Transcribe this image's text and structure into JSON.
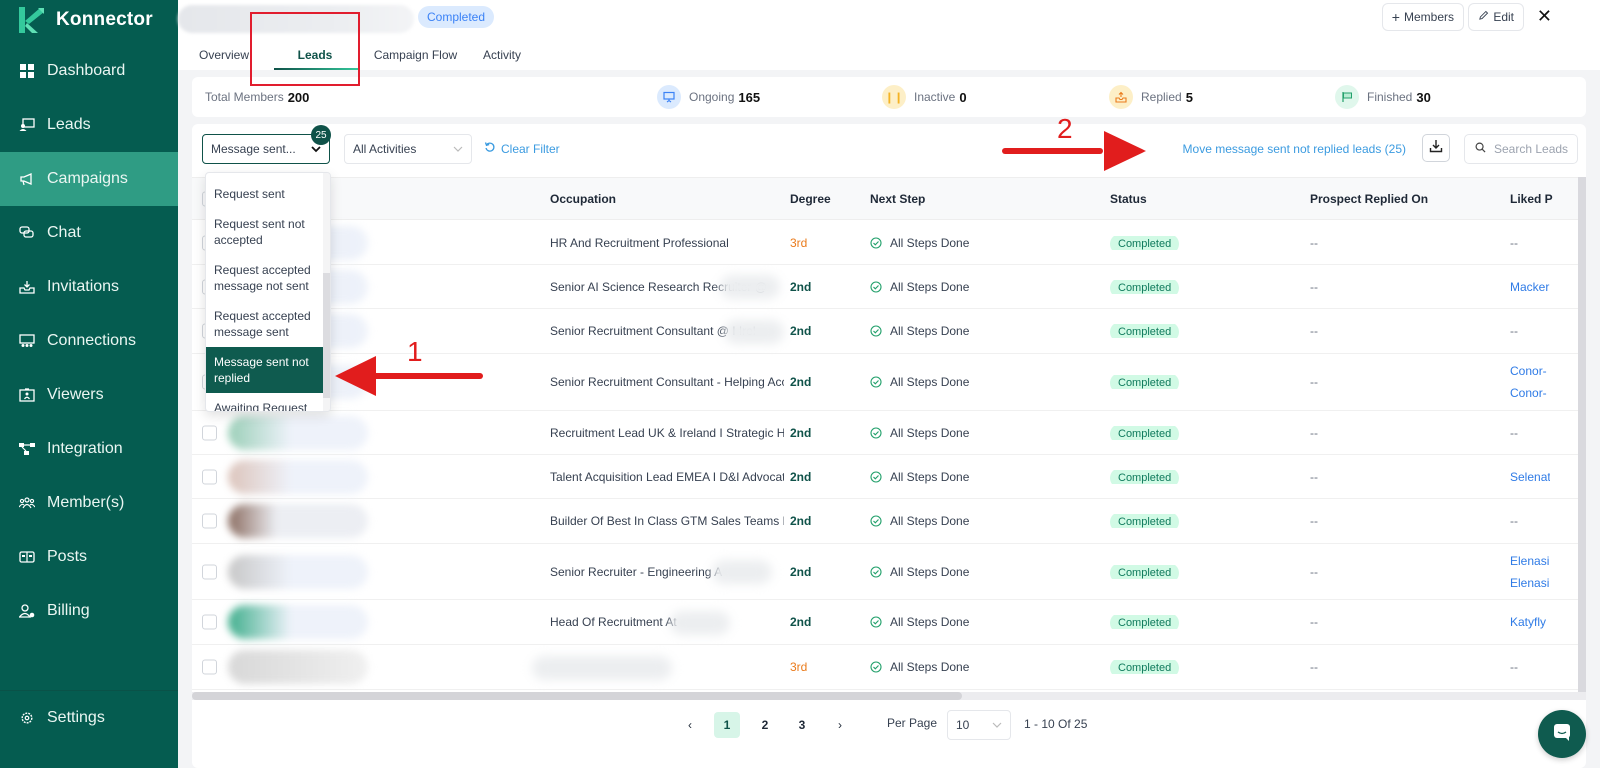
{
  "app": {
    "name": "Konnector"
  },
  "sidebar": {
    "items": [
      {
        "label": "Dashboard",
        "icon": "dashboard-icon"
      },
      {
        "label": "Leads",
        "icon": "leads-icon"
      },
      {
        "label": "Campaigns",
        "icon": "megaphone-icon",
        "active": true
      },
      {
        "label": "Chat",
        "icon": "chat-icon"
      },
      {
        "label": "Invitations",
        "icon": "inbox-download-icon"
      },
      {
        "label": "Connections",
        "icon": "connections-icon"
      },
      {
        "label": "Viewers",
        "icon": "id-badge-icon"
      },
      {
        "label": "Integration",
        "icon": "integration-icon"
      },
      {
        "label": "Member(s)",
        "icon": "members-icon"
      },
      {
        "label": "Posts",
        "icon": "posts-icon"
      },
      {
        "label": "Billing",
        "icon": "billing-user-icon"
      }
    ],
    "settings_label": "Settings"
  },
  "header": {
    "status": "Completed",
    "members_button": "Members",
    "edit_button": "Edit",
    "tabs": [
      {
        "label": "Overview"
      },
      {
        "label": "Leads",
        "active": true
      },
      {
        "label": "Campaign Flow"
      },
      {
        "label": "Activity"
      }
    ]
  },
  "stats": {
    "total_members": {
      "label": "Total Members",
      "value": "200"
    },
    "ongoing": {
      "label": "Ongoing",
      "value": "165"
    },
    "inactive": {
      "label": "Inactive",
      "value": "0"
    },
    "replied": {
      "label": "Replied",
      "value": "5"
    },
    "finished": {
      "label": "Finished",
      "value": "30"
    }
  },
  "filters": {
    "status_filter": {
      "value": "Message sent...",
      "badge": "25"
    },
    "activity_filter": {
      "value": "All Activities"
    },
    "clear_label": "Clear Filter",
    "move_link": "Move message sent not replied leads (25)",
    "search_placeholder": "Search Leads",
    "dropdown_options": [
      {
        "label": "Request sent"
      },
      {
        "label": "Request sent not accepted"
      },
      {
        "label": "Request accepted message not sent"
      },
      {
        "label": "Request accepted message sent"
      },
      {
        "label": "Message sent not replied",
        "selected": true
      },
      {
        "label": "Awaiting Request"
      }
    ]
  },
  "table": {
    "columns": [
      "Occupation",
      "Degree",
      "Next Step",
      "Status",
      "Prospect Replied On",
      "Liked P"
    ],
    "rows": [
      {
        "occupation": "HR And Recruitment Professional",
        "degree": "3rd",
        "next_step": "All Steps Done",
        "status": "Completed",
        "replied_on": "--",
        "liked": [
          "--"
        ]
      },
      {
        "occupation": "Senior AI Science Research Recruiter @",
        "degree": "2nd",
        "next_step": "All Steps Done",
        "status": "Completed",
        "replied_on": "--",
        "liked": [
          "Macker"
        ]
      },
      {
        "occupation": "Senior Recruitment Consultant @ I Irel",
        "degree": "2nd",
        "next_step": "All Steps Done",
        "status": "Completed",
        "replied_on": "--",
        "liked": [
          "--"
        ]
      },
      {
        "occupation": "Senior Recruitment Consultant - Helping Acc",
        "degree": "2nd",
        "next_step": "All Steps Done",
        "status": "Completed",
        "replied_on": "--",
        "liked": [
          "Conor-",
          "Conor-"
        ]
      },
      {
        "occupation": "Recruitment Lead UK & Ireland I Strategic Hiri",
        "degree": "2nd",
        "next_step": "All Steps Done",
        "status": "Completed",
        "replied_on": "--",
        "liked": [
          "--"
        ]
      },
      {
        "occupation": "Talent Acquisition Lead EMEA I D&I Advocate",
        "degree": "2nd",
        "next_step": "All Steps Done",
        "status": "Completed",
        "replied_on": "--",
        "liked": [
          "Selenat"
        ]
      },
      {
        "occupation": "Builder Of Best In Class GTM Sales Teams I Re",
        "degree": "2nd",
        "next_step": "All Steps Done",
        "status": "Completed",
        "replied_on": "--",
        "liked": [
          "--"
        ]
      },
      {
        "occupation": "Senior Recruiter - Engineering A",
        "degree": "2nd",
        "next_step": "All Steps Done",
        "status": "Completed",
        "replied_on": "--",
        "liked": [
          "Elenasi",
          "Elenasi"
        ]
      },
      {
        "occupation": "Head Of Recruitment At",
        "degree": "2nd",
        "next_step": "All Steps Done",
        "status": "Completed",
        "replied_on": "--",
        "liked": [
          "Katyfly"
        ]
      },
      {
        "occupation": "",
        "degree": "3rd",
        "next_step": "All Steps Done",
        "status": "Completed",
        "replied_on": "--",
        "liked": [
          "--"
        ]
      }
    ]
  },
  "pagination": {
    "pages": [
      "1",
      "2",
      "3"
    ],
    "current": "1",
    "prev": "‹",
    "next": "›",
    "per_page_label": "Per Page",
    "per_page_value": "10",
    "range": "1 - 10 Of 25"
  },
  "annotations": {
    "arrow1_label": "1",
    "arrow2_label": "2"
  },
  "colors": {
    "brand": "#055c50",
    "active_nav": "#2f9c84",
    "link": "#3b9be0",
    "annotation": "#e11d1d"
  }
}
